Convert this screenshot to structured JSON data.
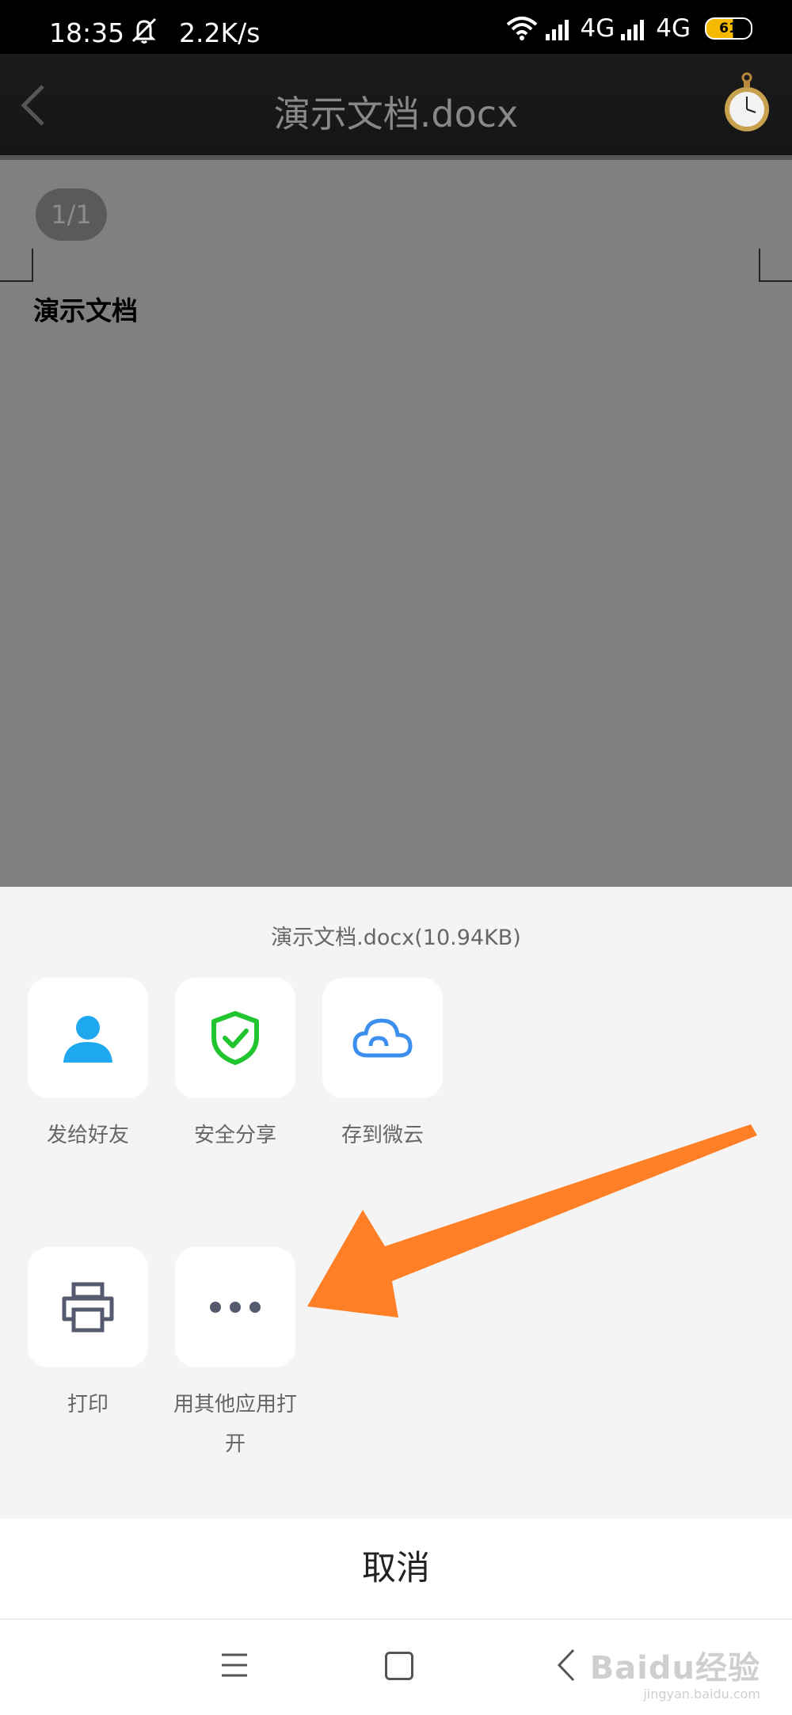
{
  "status_bar": {
    "time": "18:35",
    "speed": "2.2K/s",
    "network1": "4G",
    "network2": "4G",
    "battery": "61",
    "icons": [
      "bell-off-icon",
      "wifi-icon",
      "signal-icon",
      "battery-icon"
    ]
  },
  "title_bar": {
    "title": "演示文档.docx",
    "back_icon": "chevron-left-icon",
    "clock_icon": "pocket-watch-icon"
  },
  "document": {
    "page_indicator": "1/1",
    "heading": "演示文档"
  },
  "share_sheet": {
    "file_info": "演示文档.docx(10.94KB)",
    "row1": [
      {
        "label": "发给好友",
        "icon": "user-icon",
        "color": "#1ea8f0"
      },
      {
        "label": "安全分享",
        "icon": "shield-check-icon",
        "color": "#21c530"
      },
      {
        "label": "存到微云",
        "icon": "cloud-icon",
        "color": "#3d8fef"
      }
    ],
    "row2": [
      {
        "label": "打印",
        "icon": "printer-icon",
        "color": "#555a6e"
      },
      {
        "label": "用其他应用打开",
        "icon": "more-dots-icon",
        "color": "#555a6e"
      }
    ],
    "more_label_line1": "用其他应用打",
    "more_label_line2": "开"
  },
  "annotation_arrow_color": "#ff7f27",
  "cancel": "取消",
  "nav_bar": {
    "icons": [
      "menu-icon",
      "home-icon",
      "back-icon"
    ],
    "watermark": "Baidu经验",
    "watermark_sub": "jingyan.baidu.com"
  }
}
